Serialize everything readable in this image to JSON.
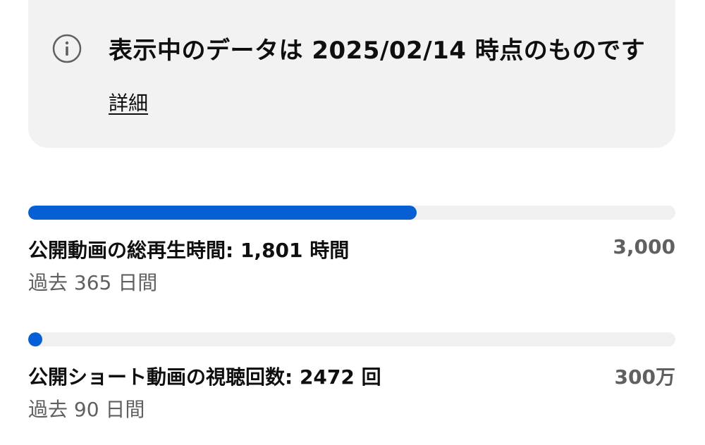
{
  "notice": {
    "icon": "info-icon",
    "text": "表示中のデータは 2025/02/14 時点のものです",
    "link_label": "詳細"
  },
  "metrics": [
    {
      "label": "公開動画の総再生時間: 1,801 時間",
      "period": "過去 365 日間",
      "target": "3,000",
      "progress_fraction": 0.6
    },
    {
      "label": "公開ショート動画の視聴回数: 2472 回",
      "period": "過去 90 日間",
      "target": "300万",
      "progress_fraction": 0.00082
    }
  ],
  "colors": {
    "accent": "#065fd4",
    "track": "#f0f0f0",
    "card_bg": "#f2f2f2",
    "muted_text": "#606060"
  }
}
